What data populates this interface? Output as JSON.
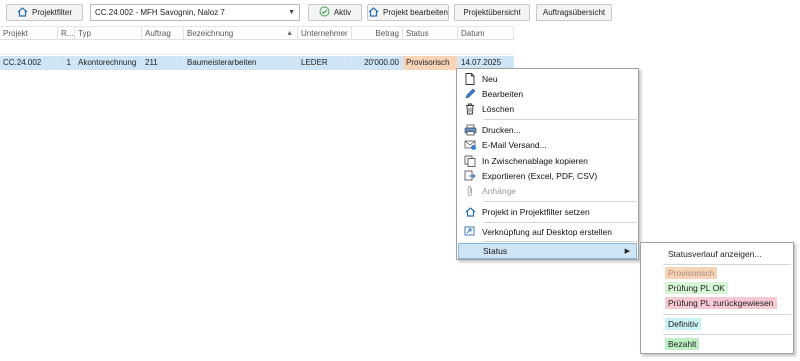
{
  "toolbar": {
    "projektfilter_label": "Projektfilter",
    "project_combo_value": "CC.24.002 - MFH Savognin, Naloz 7",
    "aktiv_label": "Aktiv",
    "projekt_bearbeiten_label": "Projekt bearbeiten",
    "projektuebersicht_label": "Projektübersicht",
    "auftragsuebersicht_label": "Auftragsübersicht"
  },
  "grid": {
    "columns": [
      "Projekt",
      "R...",
      "Typ",
      "Auftrag",
      "Bezeichnung",
      "Unternehmer",
      "Betrag",
      "Status",
      "Datum"
    ],
    "row": {
      "projekt": "CC.24.002",
      "r": "1",
      "typ": "Akontorechnung",
      "auftrag": "211",
      "bezeichnung": "Baumeisterarbeiten",
      "unternehmer": "LEDER",
      "betrag": "20'000.00",
      "status": "Provisorisch",
      "datum": "14.07.2025"
    }
  },
  "context_menu": {
    "items": [
      "Neu",
      "Bearbeiten",
      "Löschen",
      "Drucken...",
      "E-Mail Versand...",
      "In Zwischenablage kopieren",
      "Exportieren (Excel, PDF, CSV)",
      "Anhänge",
      "Projekt in Projektfilter setzen",
      "Verknüpfung auf Desktop erstellen",
      "Status"
    ]
  },
  "status_submenu": {
    "verlauf": "Statusverlauf anzeigen...",
    "provisorisch": "Provisorisch",
    "pruefung_ok": "Prüfung PL OK",
    "pruefung_zurueck": "Prüfung PL zurückgewiesen",
    "definitiv": "Definitiv",
    "bezahlt": "Bezahlt"
  },
  "colors": {
    "selection": "#cfe4f5",
    "provisorisch": "#f7d3b8",
    "pruefung_ok": "#d7f5d7",
    "pruefung_zurueck": "#f7c9d3",
    "definitiv": "#c9f2f7",
    "bezahlt": "#bff0c4"
  }
}
